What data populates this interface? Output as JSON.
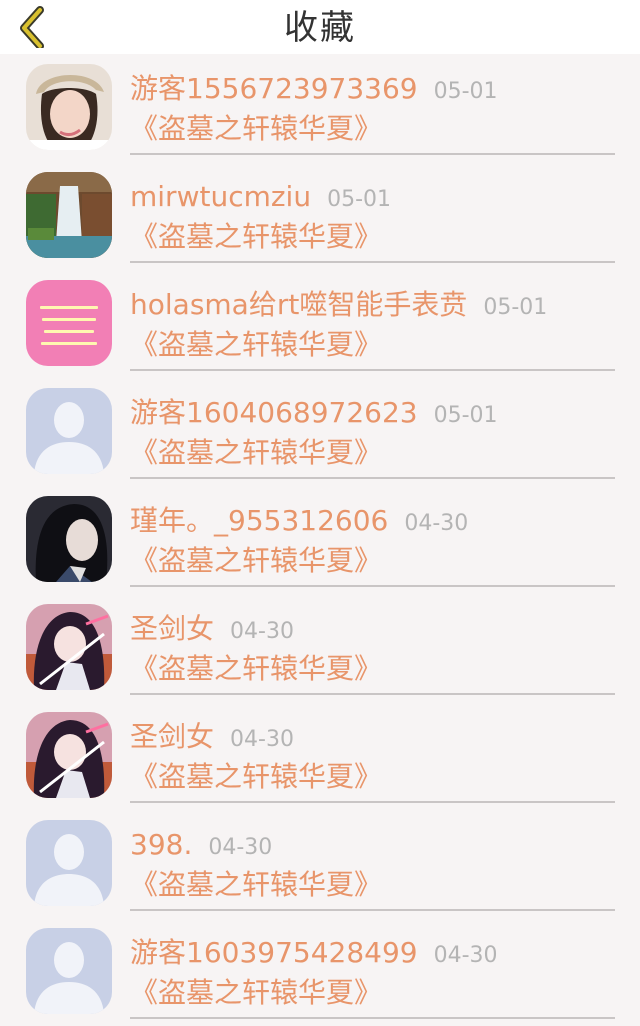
{
  "header": {
    "title": "收藏",
    "back_icon": "chevron-left-icon",
    "accent_color": "#d9c12f"
  },
  "items": [
    {
      "user": "游客1556723973369",
      "date": "05-01",
      "book": "《盗墓之轩辕华夏》",
      "avatar": "photo-girl"
    },
    {
      "user": "mirwtucmziu",
      "date": "05-01",
      "book": "《盗墓之轩辕华夏》",
      "avatar": "waterfall"
    },
    {
      "user": "holasma给rt噬智能手表贲",
      "date": "05-01",
      "book": "《盗墓之轩辕华夏》",
      "avatar": "pink-text"
    },
    {
      "user": "游客1604068972623",
      "date": "05-01",
      "book": "《盗墓之轩辕华夏》",
      "avatar": "default-person"
    },
    {
      "user": "瑾年。_955312606",
      "date": "04-30",
      "book": "《盗墓之轩辕华夏》",
      "avatar": "dark-girl"
    },
    {
      "user": "圣剑女",
      "date": "04-30",
      "book": "《盗墓之轩辕华夏》",
      "avatar": "anime-girl"
    },
    {
      "user": "圣剑女",
      "date": "04-30",
      "book": "《盗墓之轩辕华夏》",
      "avatar": "anime-girl"
    },
    {
      "user": "398.",
      "date": "04-30",
      "book": "《盗墓之轩辕华夏》",
      "avatar": "default-person"
    },
    {
      "user": "游客1603975428499",
      "date": "04-30",
      "book": "《盗墓之轩辕华夏》",
      "avatar": "default-person"
    }
  ]
}
